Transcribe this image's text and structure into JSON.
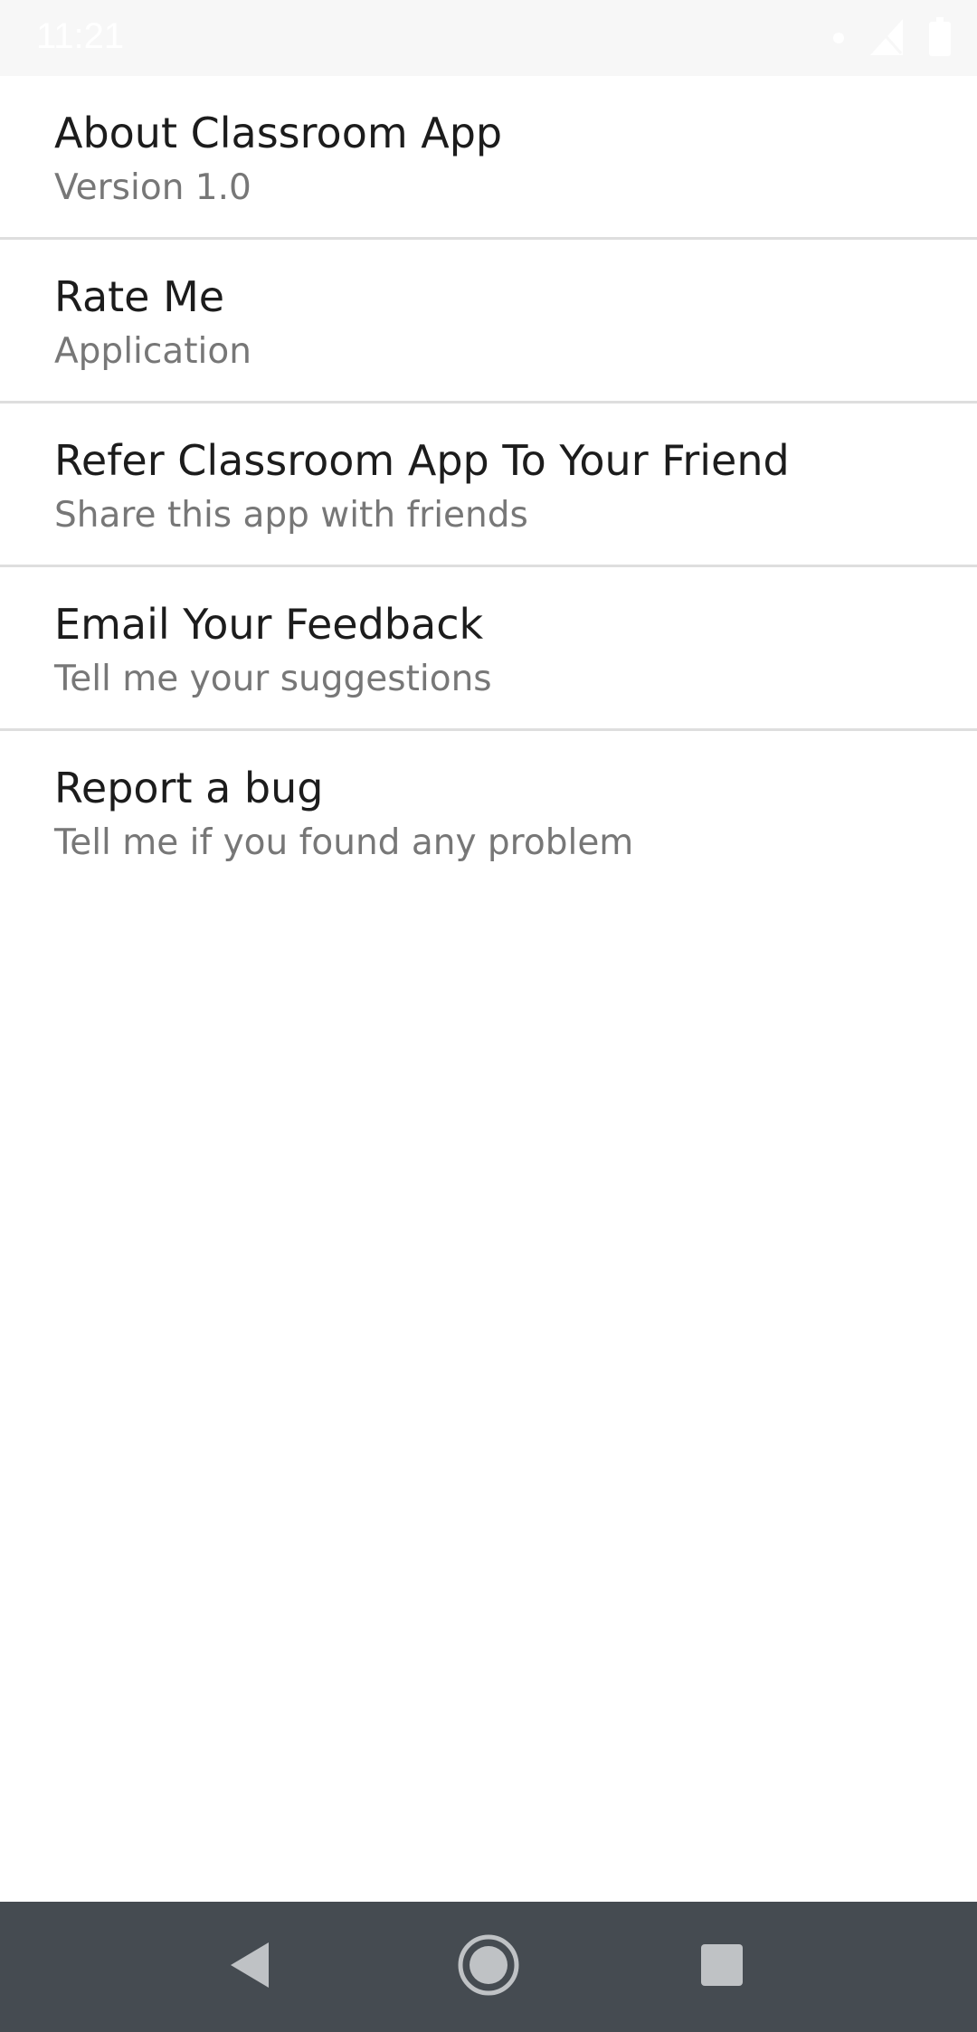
{
  "status_bar": {
    "time": "11:21",
    "icons": [
      "dot-icon",
      "signal-icon",
      "battery-icon"
    ]
  },
  "list": {
    "items": [
      {
        "title": "About Classroom App",
        "subtitle": "Version 1.0"
      },
      {
        "title": "Rate Me",
        "subtitle": "Application"
      },
      {
        "title": "Refer Classroom App To Your Friend",
        "subtitle": "Share this app with friends"
      },
      {
        "title": "Email Your Feedback",
        "subtitle": "Tell me your suggestions"
      },
      {
        "title": "Report a bug",
        "subtitle": "Tell me if you found any problem"
      }
    ]
  },
  "nav_bar": {
    "buttons": [
      "back-icon",
      "home-icon",
      "recents-icon"
    ]
  },
  "colors": {
    "title_text": "#1c1c1c",
    "subtitle_text": "#777777",
    "divider": "#dedede",
    "nav_bar_bg": "#454b51",
    "nav_icon": "#bfc2c5",
    "status_bar_bg": "#f7f7f7"
  }
}
